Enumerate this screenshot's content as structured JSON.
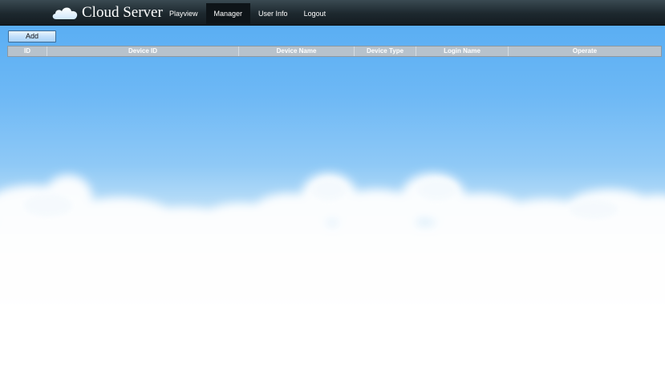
{
  "app": {
    "title": "Cloud Server",
    "logo_icon": "cloud-icon"
  },
  "nav": {
    "items": [
      {
        "label": "Playview",
        "active": false
      },
      {
        "label": "Manager",
        "active": true
      },
      {
        "label": "User Info",
        "active": false
      },
      {
        "label": "Logout",
        "active": false
      }
    ]
  },
  "toolbar": {
    "add_label": "Add"
  },
  "table": {
    "columns": [
      "ID",
      "Device ID",
      "Device Name",
      "Device Type",
      "Login Name",
      "Operate"
    ],
    "rows": []
  },
  "colors": {
    "navbar": "#1d282e",
    "sky": "#5aaef3",
    "header": "#b7c2cc"
  }
}
